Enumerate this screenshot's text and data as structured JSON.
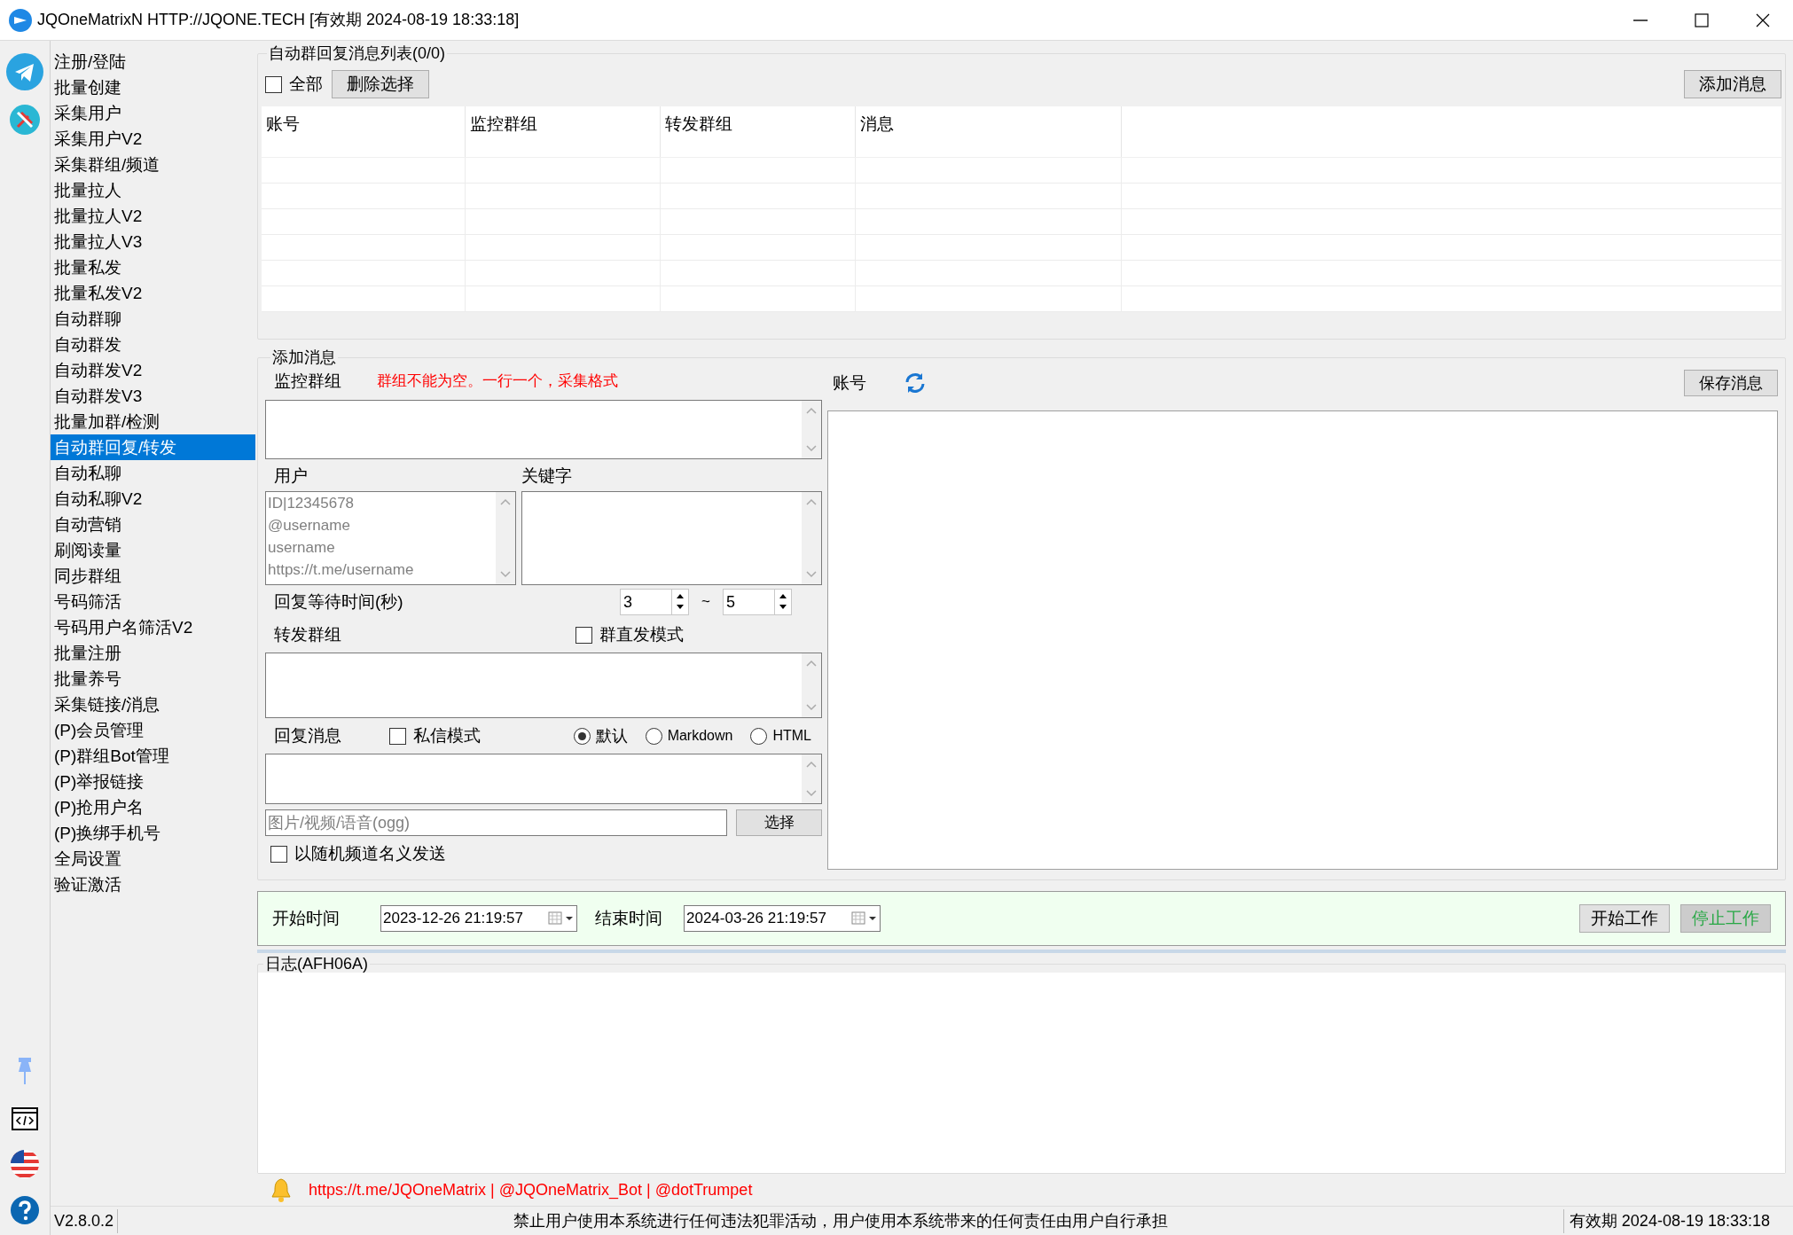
{
  "window": {
    "title": "JQOneMatrixN HTTP://JQONE.TECH [有效期 2024-08-19 18:33:18]"
  },
  "sidebar": {
    "items": [
      {
        "label": "注册/登陆",
        "selected": false
      },
      {
        "label": "批量创建",
        "selected": false
      },
      {
        "label": "采集用户",
        "selected": false
      },
      {
        "label": "采集用户V2",
        "selected": false
      },
      {
        "label": "采集群组/频道",
        "selected": false
      },
      {
        "label": "批量拉人",
        "selected": false
      },
      {
        "label": "批量拉人V2",
        "selected": false
      },
      {
        "label": "批量拉人V3",
        "selected": false
      },
      {
        "label": "批量私发",
        "selected": false
      },
      {
        "label": "批量私发V2",
        "selected": false
      },
      {
        "label": "自动群聊",
        "selected": false
      },
      {
        "label": "自动群发",
        "selected": false
      },
      {
        "label": "自动群发V2",
        "selected": false
      },
      {
        "label": "自动群发V3",
        "selected": false
      },
      {
        "label": "批量加群/检测",
        "selected": false
      },
      {
        "label": "自动群回复/转发",
        "selected": true
      },
      {
        "label": "自动私聊",
        "selected": false
      },
      {
        "label": "自动私聊V2",
        "selected": false
      },
      {
        "label": "自动营销",
        "selected": false
      },
      {
        "label": "刷阅读量",
        "selected": false
      },
      {
        "label": "同步群组",
        "selected": false
      },
      {
        "label": "号码筛活",
        "selected": false
      },
      {
        "label": "号码用户名筛活V2",
        "selected": false
      },
      {
        "label": "批量注册",
        "selected": false
      },
      {
        "label": "批量养号",
        "selected": false
      },
      {
        "label": "采集链接/消息",
        "selected": false
      },
      {
        "label": "(P)会员管理",
        "selected": false
      },
      {
        "label": "(P)群组Bot管理",
        "selected": false
      },
      {
        "label": "(P)举报链接",
        "selected": false
      },
      {
        "label": "(P)抢用户名",
        "selected": false
      },
      {
        "label": "(P)换绑手机号",
        "selected": false
      },
      {
        "label": "全局设置",
        "selected": false
      },
      {
        "label": "验证激活",
        "selected": false
      }
    ]
  },
  "reply_list": {
    "title": "自动群回复消息列表(0/0)",
    "select_all": {
      "label": "全部",
      "checked": false
    },
    "delete_button": "删除选择",
    "add_button": "添加消息",
    "columns": [
      "账号",
      "监控群组",
      "转发群组",
      "消息"
    ]
  },
  "add_message": {
    "title": "添加消息",
    "monitor_groups": {
      "label": "监控群组",
      "hint": "群组不能为空。一行一个，采集格式"
    },
    "users": {
      "label": "用户",
      "placeholder": "ID|12345678\n@username\nusername\nhttps://t.me/username"
    },
    "keywords": {
      "label": "关键字"
    },
    "wait_time": {
      "label": "回复等待时间(秒)",
      "min": "3",
      "separator": "~",
      "max": "5"
    },
    "forward_groups": {
      "label": "转发群组",
      "direct_mode": {
        "label": "群直发模式",
        "checked": false
      }
    },
    "reply_message": {
      "label": "回复消息",
      "private_mode": {
        "label": "私信模式",
        "checked": false
      },
      "formats": [
        {
          "label": "默认",
          "selected": true
        },
        {
          "label": "Markdown",
          "selected": false
        },
        {
          "label": "HTML",
          "selected": false
        }
      ]
    },
    "media": {
      "placeholder": "图片/视频/语音(ogg)",
      "button": "选择"
    },
    "random_channel": {
      "label": "以随机频道名义发送",
      "checked": false
    },
    "accounts": {
      "label": "账号"
    },
    "save_button": "保存消息"
  },
  "schedule": {
    "start_label": "开始时间",
    "start": "2023-12-26 21:19:57",
    "end_label": "结束时间",
    "end": "2024-03-26 21:19:57",
    "buttons": [
      {
        "label": "开始工作",
        "kind": "normal"
      },
      {
        "label": "停止工作",
        "kind": "stop"
      }
    ]
  },
  "log": {
    "title": "日志(AFH06A)"
  },
  "notice": "https://t.me/JQOneMatrix | @JQOneMatrix_Bot | @dotTrumpet",
  "status_bar": {
    "version": "V2.8.0.2",
    "disclaimer": "禁止用户使用本系统进行任何违法犯罪活动，用户使用本系统带来的任何责任由用户自行承担",
    "expiry": "有效期 2024-08-19 18:33:18"
  }
}
